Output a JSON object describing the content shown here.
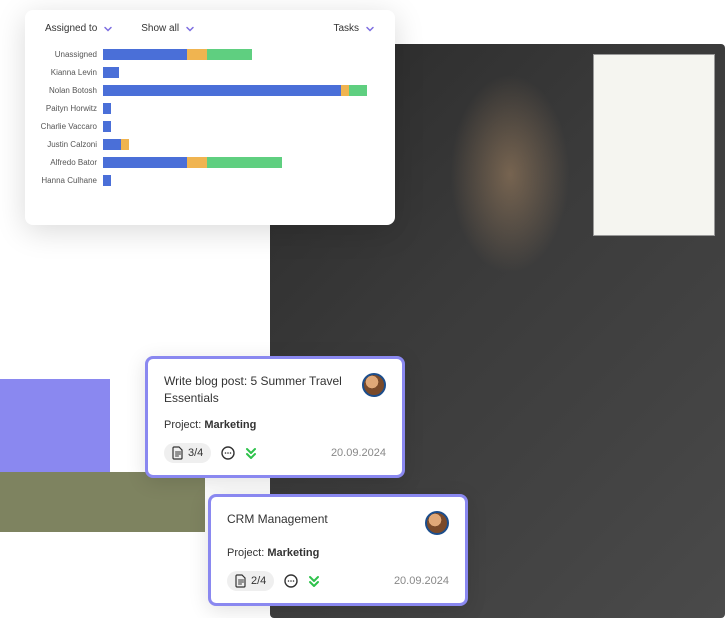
{
  "colors": {
    "purple": "#8a88f0",
    "blue": "#4a6fd8",
    "orange": "#f0b450",
    "green": "#5fcf80",
    "olive": "#7e8360"
  },
  "chart": {
    "filters": {
      "assigned": "Assigned to",
      "show": "Show all",
      "tasks": "Tasks"
    }
  },
  "chart_data": {
    "type": "bar",
    "title": "",
    "xlabel": "",
    "ylabel": "",
    "x_max": 280,
    "categories": [
      "Unassigned",
      "Kianna Levin",
      "Nolan Botosh",
      "Paityn Horwitz",
      "Charlie Vaccaro",
      "Justin Calzoni",
      "Alfredo Bator",
      "Hanna Culhane"
    ],
    "series": [
      {
        "name": "blue",
        "color": "#4a6fd8",
        "values": [
          85,
          16,
          240,
          8,
          8,
          18,
          85,
          8
        ]
      },
      {
        "name": "orange",
        "color": "#f0b450",
        "values": [
          20,
          0,
          8,
          0,
          0,
          8,
          20,
          0
        ]
      },
      {
        "name": "green",
        "color": "#5fcf80",
        "values": [
          45,
          0,
          18,
          0,
          0,
          0,
          75,
          0
        ]
      }
    ]
  },
  "tasks": [
    {
      "title": "Write blog post: 5 Summer Travel Essentials",
      "project_label": "Project: ",
      "project_name": "Marketing",
      "attachments": "3/4",
      "date": "20.09.2024"
    },
    {
      "title": "CRM Management",
      "project_label": "Project: ",
      "project_name": "Marketing",
      "attachments": "2/4",
      "date": "20.09.2024"
    }
  ]
}
